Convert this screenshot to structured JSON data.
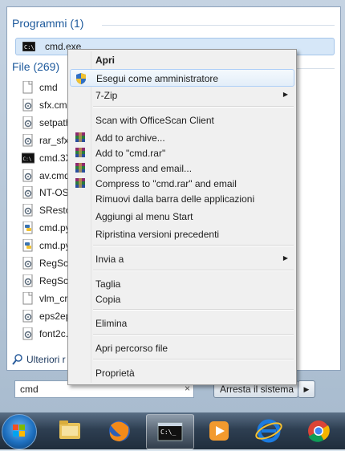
{
  "start_menu": {
    "programs_header": "Programmi (1)",
    "program_item": "cmd.exe",
    "files_header": "File (269)",
    "files": [
      {
        "label": "cmd",
        "icon": "document-icon"
      },
      {
        "label": "sfx.cmd",
        "icon": "script-icon"
      },
      {
        "label": "setpath",
        "icon": "script-icon"
      },
      {
        "label": "rar_sfx.",
        "icon": "script-icon"
      },
      {
        "label": "cmd.3X",
        "icon": "console-icon"
      },
      {
        "label": "av.cmd",
        "icon": "script-icon"
      },
      {
        "label": "NT-OS",
        "icon": "script-icon"
      },
      {
        "label": "SResto",
        "icon": "script-icon"
      },
      {
        "label": "cmd.py",
        "icon": "python-icon"
      },
      {
        "label": "cmd.py",
        "icon": "python-icon"
      },
      {
        "label": "RegSca",
        "icon": "script-icon"
      },
      {
        "label": "RegSca",
        "icon": "script-icon"
      },
      {
        "label": "vlm_cr",
        "icon": "document-icon"
      },
      {
        "label": "eps2ep",
        "icon": "script-icon"
      },
      {
        "label": "font2c.",
        "icon": "script-icon"
      }
    ],
    "more_results": "Ulteriori r",
    "search_value": "cmd",
    "search_clear": "×",
    "shutdown_label": "Arresta il sistema",
    "shutdown_arrow": "▶"
  },
  "context_menu": {
    "items": [
      {
        "label": "Apri",
        "bold": true
      },
      {
        "label": "Esegui come amministratore",
        "icon": "uac-shield-icon"
      },
      {
        "label": "7-Zip",
        "submenu": true
      },
      {
        "label": "Scan with OfficeScan Client"
      },
      {
        "label": "Add to archive...",
        "icon": "winrar-icon"
      },
      {
        "label": "Add to \"cmd.rar\"",
        "icon": "winrar-icon"
      },
      {
        "label": "Compress and email...",
        "icon": "winrar-icon"
      },
      {
        "label": "Compress to \"cmd.rar\" and email",
        "icon": "winrar-icon"
      },
      {
        "label": "Rimuovi dalla barra delle applicazioni"
      },
      {
        "label": "Aggiungi al menu Start"
      },
      {
        "label": "Ripristina versioni precedenti"
      },
      {
        "label": "Invia a",
        "submenu": true
      },
      {
        "label": "Taglia"
      },
      {
        "label": "Copia"
      },
      {
        "label": "Elimina"
      },
      {
        "label": "Apri percorso file"
      },
      {
        "label": "Proprietà"
      }
    ],
    "submenu_arrow": "▶"
  },
  "taskbar": {
    "apps": [
      "start-button",
      "explorer",
      "firefox",
      "cmd",
      "media-player",
      "internet-explorer",
      "chrome"
    ]
  }
}
